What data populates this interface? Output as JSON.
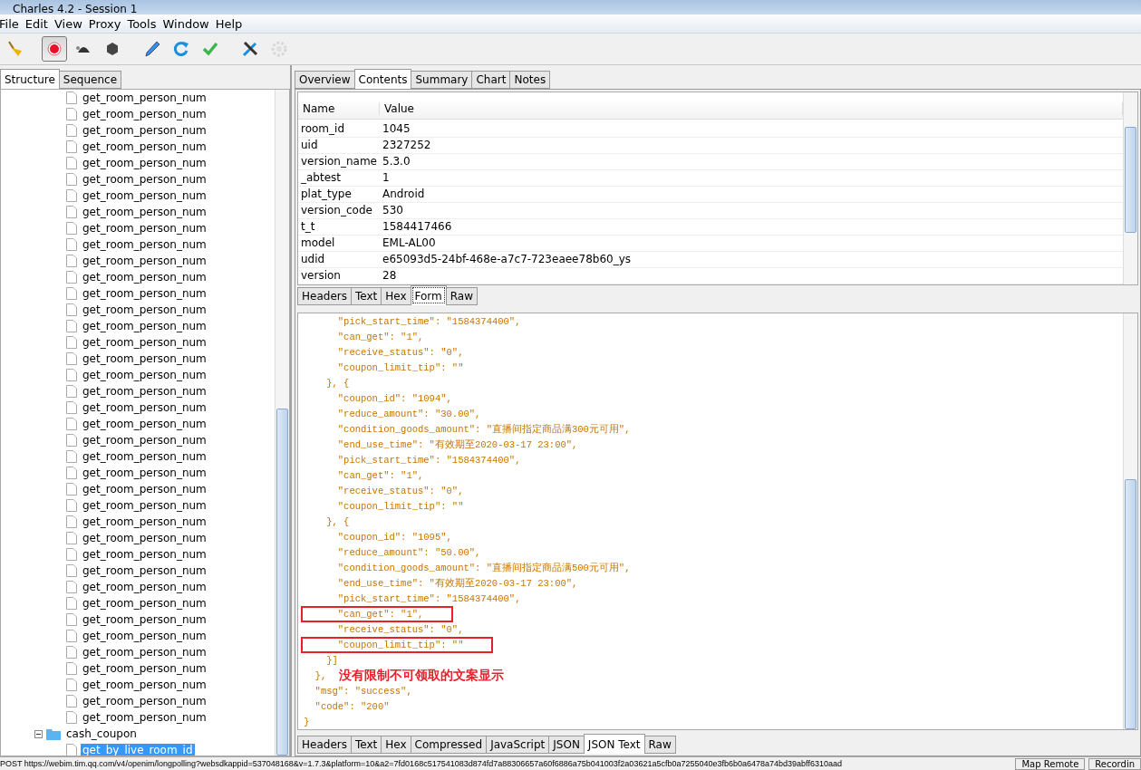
{
  "window": {
    "title": "Charles 4.2 - Session 1"
  },
  "menu": [
    "File",
    "Edit",
    "View",
    "Proxy",
    "Tools",
    "Window",
    "Help"
  ],
  "toolbar": [
    {
      "kind": "broom",
      "pressed": false,
      "disabled": false
    },
    {
      "kind": "record",
      "pressed": true,
      "disabled": false
    },
    {
      "kind": "turtle",
      "pressed": false,
      "disabled": false
    },
    {
      "kind": "stop",
      "pressed": false,
      "disabled": false
    },
    {
      "kind": "pen",
      "pressed": false,
      "disabled": false
    },
    {
      "kind": "refresh",
      "pressed": false,
      "disabled": false
    },
    {
      "kind": "check",
      "pressed": false,
      "disabled": false
    },
    {
      "kind": "tools",
      "pressed": false,
      "disabled": false
    },
    {
      "kind": "gear",
      "pressed": false,
      "disabled": true
    }
  ],
  "left_tabs": [
    {
      "label": "Structure",
      "selected": true
    },
    {
      "label": "Sequence",
      "selected": false
    }
  ],
  "tree": {
    "scrolled_children": [
      {
        "label": "get_room_person_num",
        "selected": false
      },
      {
        "label": "get_room_person_num",
        "selected": false
      },
      {
        "label": "get_room_person_num",
        "selected": false
      },
      {
        "label": "get_room_person_num",
        "selected": false
      },
      {
        "label": "get_room_person_num",
        "selected": false
      },
      {
        "label": "get_room_person_num",
        "selected": false
      },
      {
        "label": "get_room_person_num",
        "selected": false
      },
      {
        "label": "get_room_person_num",
        "selected": false
      },
      {
        "label": "get_room_person_num",
        "selected": false
      },
      {
        "label": "get_room_person_num",
        "selected": false
      },
      {
        "label": "get_room_person_num",
        "selected": false
      },
      {
        "label": "get_room_person_num",
        "selected": false
      },
      {
        "label": "get_room_person_num",
        "selected": false
      },
      {
        "label": "get_room_person_num",
        "selected": false
      },
      {
        "label": "get_room_person_num",
        "selected": false
      },
      {
        "label": "get_room_person_num",
        "selected": false
      },
      {
        "label": "get_room_person_num",
        "selected": false
      },
      {
        "label": "get_room_person_num",
        "selected": false
      },
      {
        "label": "get_room_person_num",
        "selected": false
      },
      {
        "label": "get_room_person_num",
        "selected": false
      },
      {
        "label": "get_room_person_num",
        "selected": false
      },
      {
        "label": "get_room_person_num",
        "selected": false
      },
      {
        "label": "get_room_person_num",
        "selected": false
      },
      {
        "label": "get_room_person_num",
        "selected": false
      },
      {
        "label": "get_room_person_num",
        "selected": false
      },
      {
        "label": "get_room_person_num",
        "selected": false
      },
      {
        "label": "get_room_person_num",
        "selected": false
      },
      {
        "label": "get_room_person_num",
        "selected": false
      },
      {
        "label": "get_room_person_num",
        "selected": false
      },
      {
        "label": "get_room_person_num",
        "selected": false
      },
      {
        "label": "get_room_person_num",
        "selected": false
      },
      {
        "label": "get_room_person_num",
        "selected": false
      },
      {
        "label": "get_room_person_num",
        "selected": false
      },
      {
        "label": "get_room_person_num",
        "selected": false
      },
      {
        "label": "get_room_person_num",
        "selected": false
      },
      {
        "label": "get_room_person_num",
        "selected": false
      },
      {
        "label": "get_room_person_num",
        "selected": false
      },
      {
        "label": "get_room_person_num",
        "selected": false
      },
      {
        "label": "get_room_person_num",
        "selected": false
      }
    ],
    "items": [
      {
        "label": "cash_coupon",
        "expanded": true,
        "selected": false,
        "children": [
          {
            "label": "get_by_live_room_id",
            "selected": true
          }
        ]
      }
    ]
  },
  "detail_tabs": [
    {
      "label": "Overview",
      "selected": false
    },
    {
      "label": "Contents",
      "selected": true
    },
    {
      "label": "Summary",
      "selected": false
    },
    {
      "label": "Chart",
      "selected": false
    },
    {
      "label": "Notes",
      "selected": false
    }
  ],
  "form_table": {
    "columns": [
      "Name",
      "Value"
    ],
    "rows": [
      [
        "room_id",
        "1045"
      ],
      [
        "uid",
        "2327252"
      ],
      [
        "version_name",
        "5.3.0"
      ],
      [
        "_abtest",
        "1"
      ],
      [
        "plat_type",
        "Android"
      ],
      [
        "version_code",
        "530"
      ],
      [
        "t_t",
        "1584417466"
      ],
      [
        "model",
        "EML-AL00"
      ],
      [
        "udid",
        "e65093d5-24bf-468e-a7c7-723eaee78b60_ys"
      ],
      [
        "version",
        "28"
      ]
    ]
  },
  "request_tabs": [
    {
      "label": "Headers",
      "selected": false
    },
    {
      "label": "Text",
      "selected": false
    },
    {
      "label": "Hex",
      "selected": false
    },
    {
      "label": "Form",
      "selected": true
    },
    {
      "label": "Raw",
      "selected": false
    }
  ],
  "response_lines": [
    {
      "text": "      \"pick_start_time\": \"1584374400\",",
      "highlight": false
    },
    {
      "text": "      \"can_get\": \"1\",",
      "highlight": false
    },
    {
      "text": "      \"receive_status\": \"0\",",
      "highlight": false
    },
    {
      "text": "      \"coupon_limit_tip\": \"\"",
      "highlight": false
    },
    {
      "text": "    }, {",
      "highlight": false
    },
    {
      "text": "      \"coupon_id\": \"1094\",",
      "highlight": false
    },
    {
      "text": "      \"reduce_amount\": \"30.00\",",
      "highlight": false
    },
    {
      "text": "      \"condition_goods_amount\": \"直播间指定商品满300元可用\",",
      "highlight": false
    },
    {
      "text": "      \"end_use_time\": \"有效期至2020-03-17 23:00\",",
      "highlight": false
    },
    {
      "text": "      \"pick_start_time\": \"1584374400\",",
      "highlight": false
    },
    {
      "text": "      \"can_get\": \"1\",",
      "highlight": false
    },
    {
      "text": "      \"receive_status\": \"0\",",
      "highlight": false
    },
    {
      "text": "      \"coupon_limit_tip\": \"\"",
      "highlight": false
    },
    {
      "text": "    }, {",
      "highlight": false
    },
    {
      "text": "      \"coupon_id\": \"1095\",",
      "highlight": false
    },
    {
      "text": "      \"reduce_amount\": \"50.00\",",
      "highlight": false
    },
    {
      "text": "      \"condition_goods_amount\": \"直播间指定商品满500元可用\",",
      "highlight": false
    },
    {
      "text": "      \"end_use_time\": \"有效期至2020-03-17 23:00\",",
      "highlight": false
    },
    {
      "text": "      \"pick_start_time\": \"1584374400\",",
      "highlight": false
    },
    {
      "text": "      \"can_get\": \"1\",",
      "highlight": true
    },
    {
      "text": "      \"receive_status\": \"0\",",
      "highlight": false
    },
    {
      "text": "      \"coupon_limit_tip\": \"\"",
      "highlight": true
    },
    {
      "text": "    }]",
      "highlight": false
    },
    {
      "text": "  },",
      "highlight": false,
      "note": "没有限制不可领取的文案显示"
    },
    {
      "text": "  \"msg\": \"success\",",
      "highlight": false
    },
    {
      "text": "  \"code\": \"200\"",
      "highlight": false
    },
    {
      "text": "}",
      "highlight": false
    }
  ],
  "response_tabs": [
    {
      "label": "Headers",
      "selected": false
    },
    {
      "label": "Text",
      "selected": false
    },
    {
      "label": "Hex",
      "selected": false
    },
    {
      "label": "Compressed",
      "selected": false
    },
    {
      "label": "JavaScript",
      "selected": false
    },
    {
      "label": "JSON",
      "selected": false
    },
    {
      "label": "JSON Text",
      "selected": true
    },
    {
      "label": "Raw",
      "selected": false
    }
  ],
  "status_bar": {
    "text": "POST https://webim.tim.qq.com/v4/openim/longpolling?websdkappid=537048168&v=1.7.3&platform=10&a2=7fd0168c517541083d874fd7a88306657a60f6886a75b041003f2a03621a5cfb0a7255040e3fb6b0a6478a74bd39abff6310aad",
    "buttons": [
      "Map Remote",
      "Recordin"
    ]
  }
}
